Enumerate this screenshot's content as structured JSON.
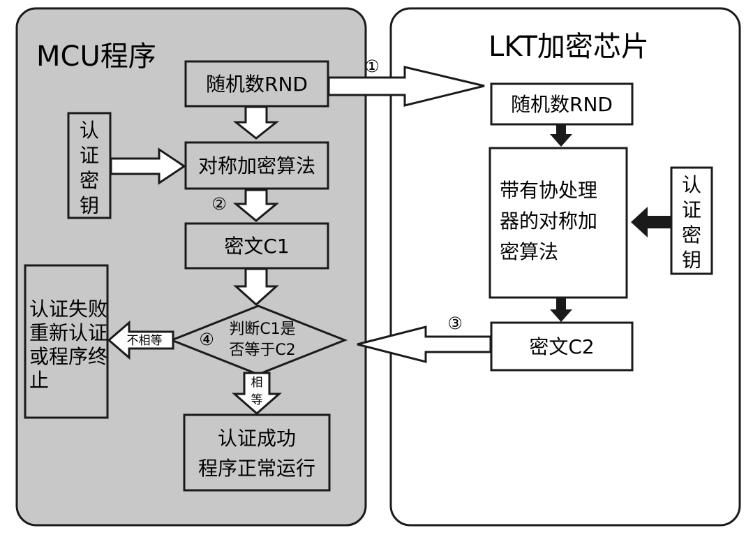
{
  "mcu_panel": {
    "title": "MCU程序",
    "random_box": "随机数RND",
    "auth_key": [
      "认",
      "证",
      "密",
      "钥"
    ],
    "encrypt_box": "对称加密算法",
    "cipher_box": "密文C1",
    "decision": [
      "判断C1是",
      "否等于C2"
    ],
    "not_equal_label": "不相等",
    "equal_label": [
      "相",
      "等"
    ],
    "fail_box": [
      "认证失败",
      "重新认证",
      "或程序终",
      "止"
    ],
    "success_box": [
      "认证成功",
      "程序正常运行"
    ]
  },
  "chip_panel": {
    "title": "LKT加密芯片",
    "random_box": "随机数RND",
    "coprocessor_box": [
      "带有协处理",
      "器的对称加",
      "密算法"
    ],
    "auth_key": [
      "认",
      "证",
      "密",
      "钥"
    ],
    "cipher_box": "密文C2"
  },
  "step_markers": {
    "step1": "①",
    "step2": "②",
    "step3": "③",
    "step4": "④"
  },
  "colors": {
    "mcu_panel_fill": "#c8c8c8",
    "chip_panel_fill": "#ffffff",
    "stroke": "#1a1a1a"
  }
}
